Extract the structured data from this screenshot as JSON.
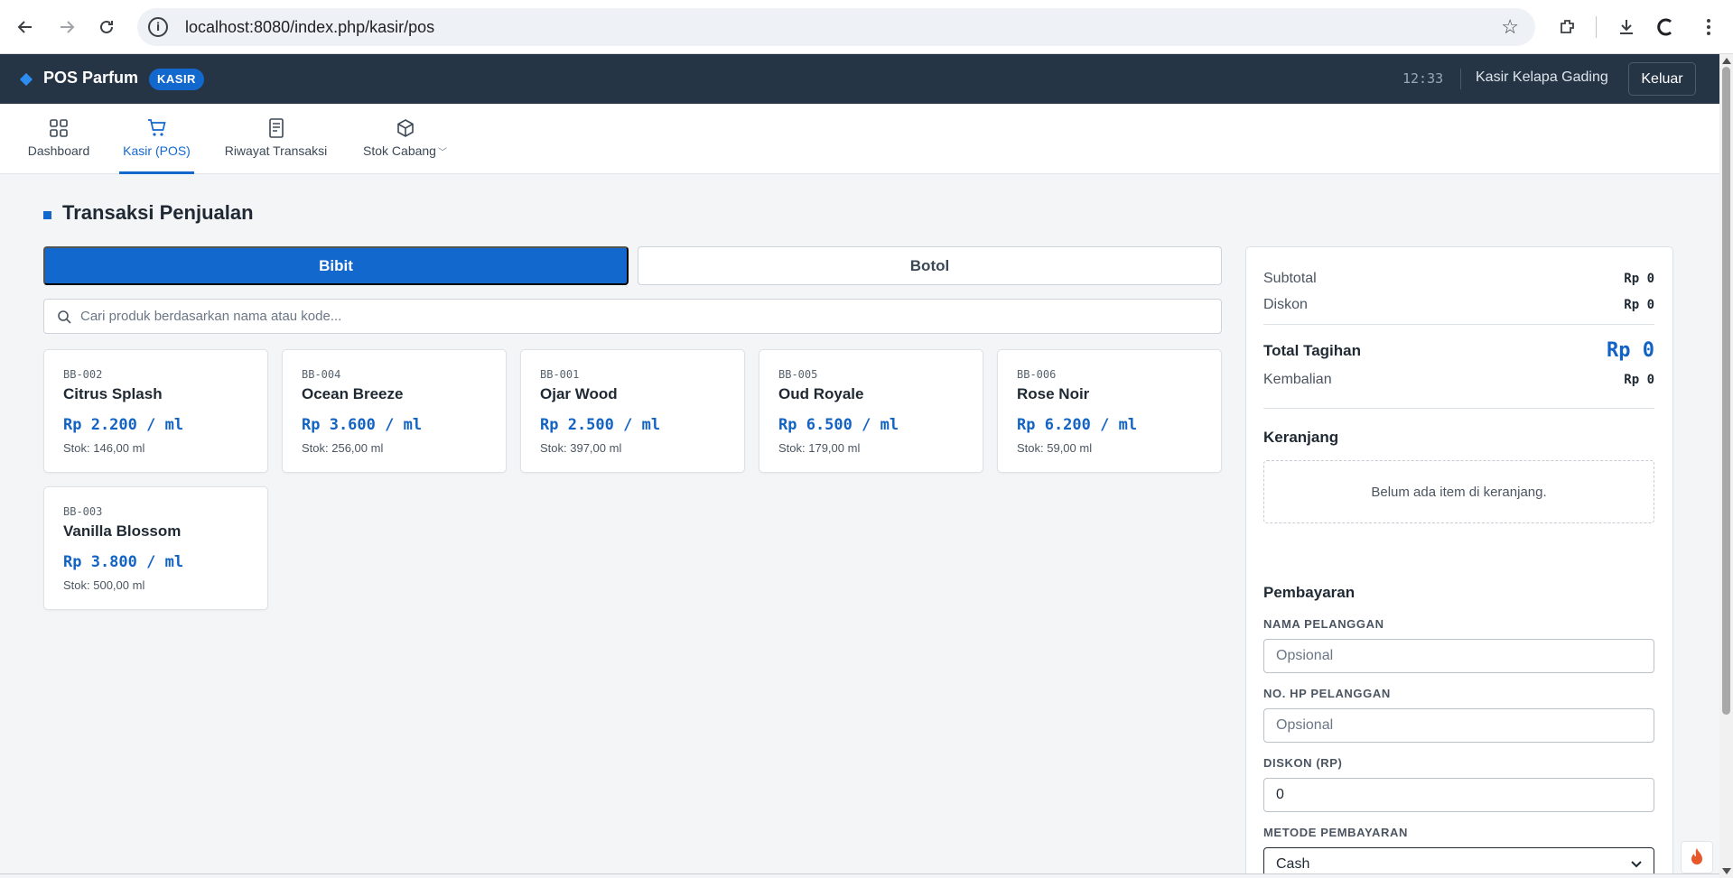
{
  "browser": {
    "url": "localhost:8080/index.php/kasir/pos"
  },
  "header": {
    "brand": "POS Parfum",
    "role_badge": "KASIR",
    "clock": "12:33",
    "branch": "Kasir Kelapa Gading",
    "logout_label": "Keluar"
  },
  "tabs": [
    {
      "label": "Dashboard",
      "icon": "grid-icon"
    },
    {
      "label": "Kasir (POS)",
      "icon": "cart-icon",
      "active": true
    },
    {
      "label": "Riwayat Transaksi",
      "icon": "receipt-icon"
    },
    {
      "label": "Stok Cabang",
      "icon": "box-icon",
      "has_dropdown": true
    }
  ],
  "main": {
    "title": "Transaksi Penjualan",
    "segments": {
      "bibit": "Bibit",
      "botol": "Botol"
    },
    "search_placeholder": "Cari produk berdasarkan nama atau kode...",
    "products": [
      {
        "code": "BB-002",
        "name": "Citrus Splash",
        "price": "Rp 2.200 / ml",
        "stock": "Stok: 146,00 ml"
      },
      {
        "code": "BB-004",
        "name": "Ocean Breeze",
        "price": "Rp 3.600 / ml",
        "stock": "Stok: 256,00 ml"
      },
      {
        "code": "BB-001",
        "name": "Ojar Wood",
        "price": "Rp 2.500 / ml",
        "stock": "Stok: 397,00 ml"
      },
      {
        "code": "BB-005",
        "name": "Oud Royale",
        "price": "Rp 6.500 / ml",
        "stock": "Stok: 179,00 ml"
      },
      {
        "code": "BB-006",
        "name": "Rose Noir",
        "price": "Rp 6.200 / ml",
        "stock": "Stok: 59,00 ml"
      },
      {
        "code": "BB-003",
        "name": "Vanilla Blossom",
        "price": "Rp 3.800 / ml",
        "stock": "Stok: 500,00 ml"
      }
    ]
  },
  "summary": {
    "subtotal_label": "Subtotal",
    "subtotal_value": "Rp 0",
    "discount_label": "Diskon",
    "discount_value": "Rp 0",
    "total_label": "Total Tagihan",
    "total_value": "Rp 0",
    "change_label": "Kembalian",
    "change_value": "Rp 0"
  },
  "cart": {
    "title": "Keranjang",
    "empty_text": "Belum ada item di keranjang."
  },
  "payment": {
    "title": "Pembayaran",
    "customer_name_label": "NAMA PELANGGAN",
    "customer_name_placeholder": "Opsional",
    "customer_phone_label": "NO. HP PELANGGAN",
    "customer_phone_placeholder": "Opsional",
    "discount_label": "DISKON (RP)",
    "discount_value": "0",
    "method_label": "METODE PEMBAYARAN",
    "method_value": "Cash"
  },
  "colors": {
    "primary": "#1368ce",
    "header_bg": "#263545",
    "price": "#1263c4"
  }
}
